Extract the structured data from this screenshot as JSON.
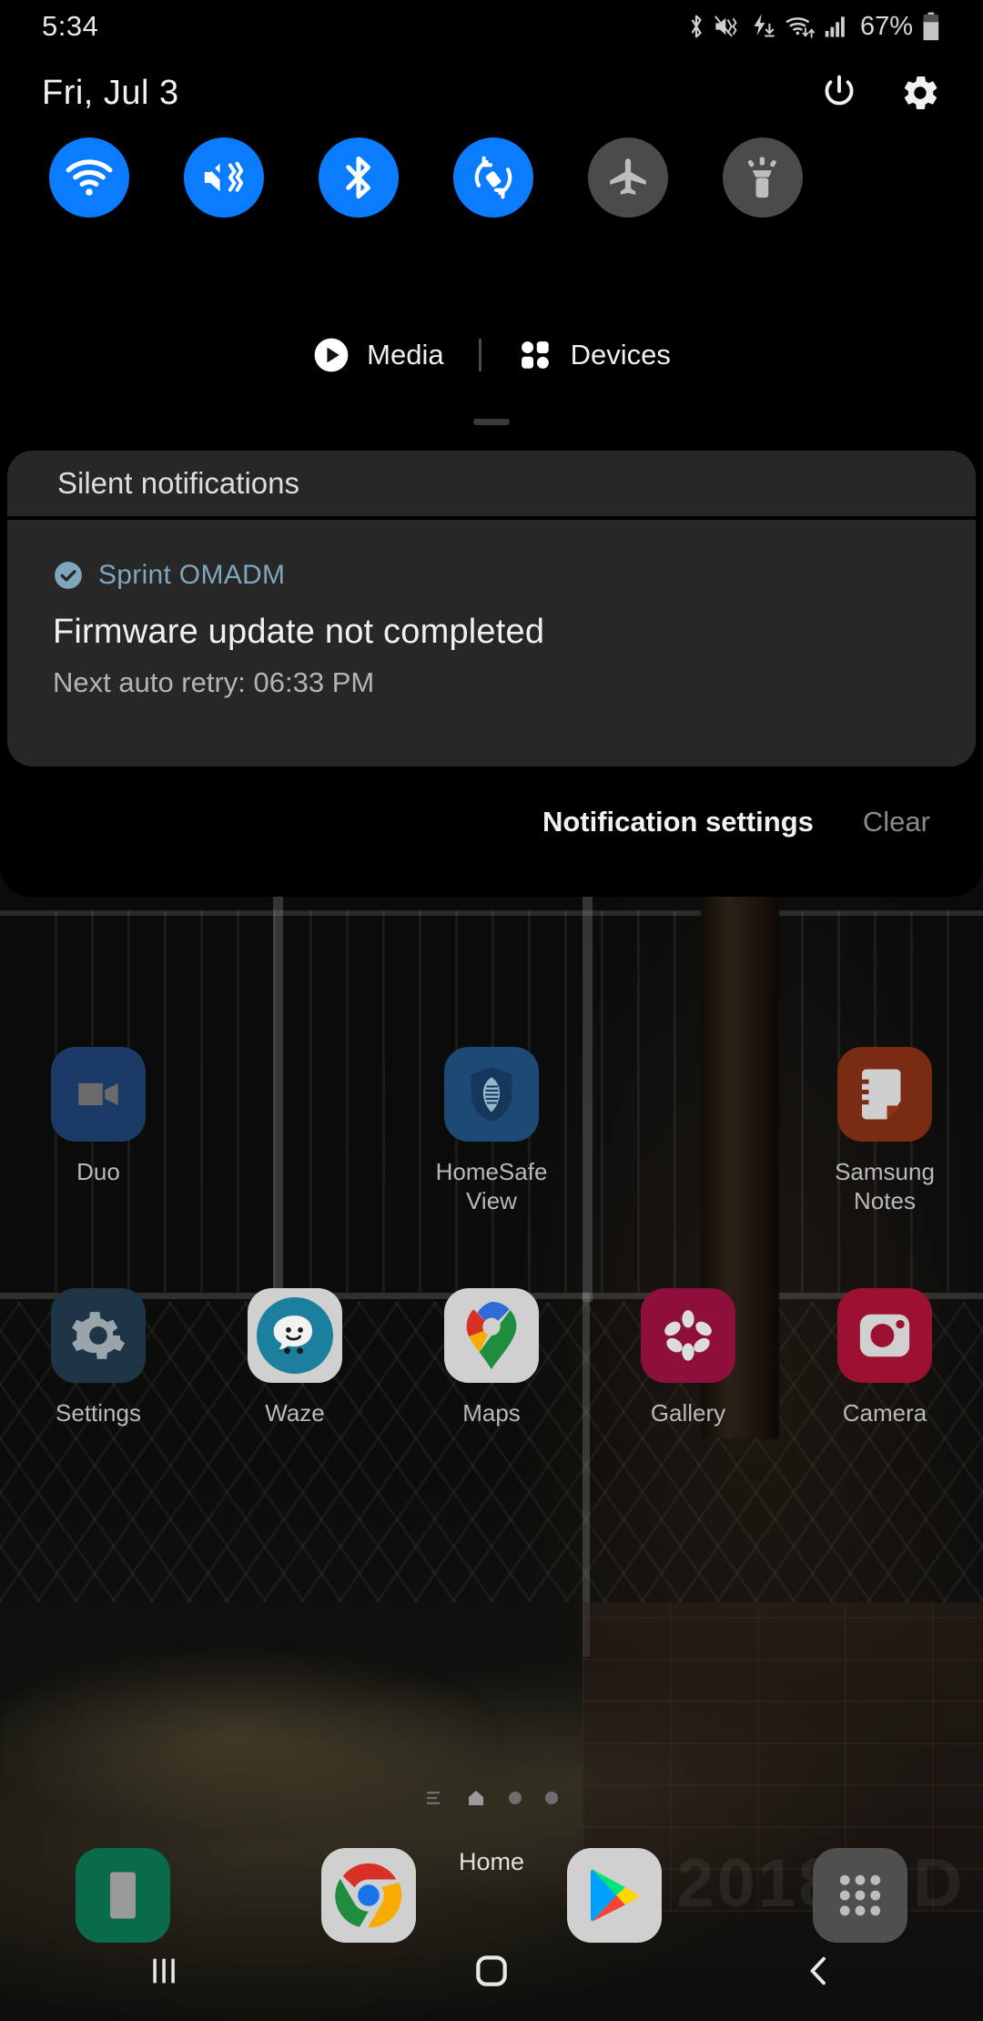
{
  "status_bar": {
    "time": "5:34",
    "battery_percent": "67%",
    "icons": [
      "bluetooth-icon",
      "mute-vibrate-icon",
      "charging-download-icon",
      "wifi-transfer-icon",
      "signal-bars-icon",
      "battery-icon"
    ]
  },
  "shade": {
    "date": "Fri, Jul 3",
    "power_icon": "power-icon",
    "settings_icon": "gear-icon",
    "toggles": [
      {
        "name": "wifi",
        "label": "Wi-Fi",
        "state": "on",
        "icon": "wifi-icon"
      },
      {
        "name": "sound",
        "label": "Mute",
        "state": "on",
        "icon": "mute-vibrate-icon"
      },
      {
        "name": "bluetooth",
        "label": "Bluetooth",
        "state": "on",
        "icon": "bluetooth-icon"
      },
      {
        "name": "auto-rotate",
        "label": "Auto rotate",
        "state": "on",
        "icon": "auto-rotate-icon"
      },
      {
        "name": "airplane",
        "label": "Airplane mode",
        "state": "off",
        "icon": "airplane-icon"
      },
      {
        "name": "flashlight",
        "label": "Flashlight",
        "state": "off",
        "icon": "flashlight-icon"
      }
    ],
    "media_label": "Media",
    "devices_label": "Devices",
    "media_icon": "play-circle-icon",
    "devices_icon": "grid-dots-icon",
    "silent_header": "Silent notifications",
    "notification": {
      "app_name": "Sprint OMADM",
      "app_icon": "check-circle-icon",
      "title": "Firmware update not completed",
      "body": "Next auto retry:  06:33 PM"
    },
    "actions": {
      "settings_label": "Notification settings",
      "clear_label": "Clear"
    }
  },
  "home": {
    "rows": [
      [
        {
          "label": "Duo",
          "icon": "duo-icon",
          "bg": "#1b3a66"
        },
        {
          "label": "",
          "icon": "",
          "bg": ""
        },
        {
          "label": "HomeSafe\nView",
          "icon": "homesafe-icon",
          "bg": "#1d4a74"
        },
        {
          "label": "",
          "icon": "",
          "bg": ""
        },
        {
          "label": "Samsung\nNotes",
          "icon": "samsung-notes-icon",
          "bg": "#7a2b14"
        }
      ],
      [
        {
          "label": "Settings",
          "icon": "settings-gear-icon",
          "bg": "#1d3547"
        },
        {
          "label": "Waze",
          "icon": "waze-icon",
          "bg": "#d8d8d8"
        },
        {
          "label": "Maps",
          "icon": "maps-pin-icon",
          "bg": "#d8d8d8"
        },
        {
          "label": "Gallery",
          "icon": "gallery-flower-icon",
          "bg": "#8e0f3c"
        },
        {
          "label": "Camera",
          "icon": "camera-icon",
          "bg": "#9c1032"
        }
      ]
    ],
    "page_indicator": {
      "pages": 4,
      "current": 1,
      "home_icon": "home-page-icon",
      "list_icon": "list-page-icon"
    },
    "dock": [
      {
        "label": "Phone",
        "icon": "phone-icon",
        "bg": "#0a6b4a"
      },
      {
        "label": "Chrome",
        "icon": "chrome-icon",
        "bg": "#d8d8d8"
      },
      {
        "label": "Play Store",
        "icon": "play-store-icon",
        "bg": "#d8d8d8"
      },
      {
        "label": "Apps",
        "icon": "app-drawer-icon",
        "bg": "#525252"
      }
    ],
    "home_label": "Home",
    "wallpaper_watermark": "2018 BD"
  },
  "navbar": {
    "recents_label": "Recents",
    "home_label": "Home",
    "back_label": "Back",
    "recents_icon": "recents-icon",
    "home_icon": "home-square-icon",
    "back_icon": "back-chevron-icon"
  },
  "colors": {
    "accent_on": "#0a7cff",
    "toggle_off": "#4b4b4b",
    "panel": "#272727",
    "app_name": "#7ea6bd"
  }
}
